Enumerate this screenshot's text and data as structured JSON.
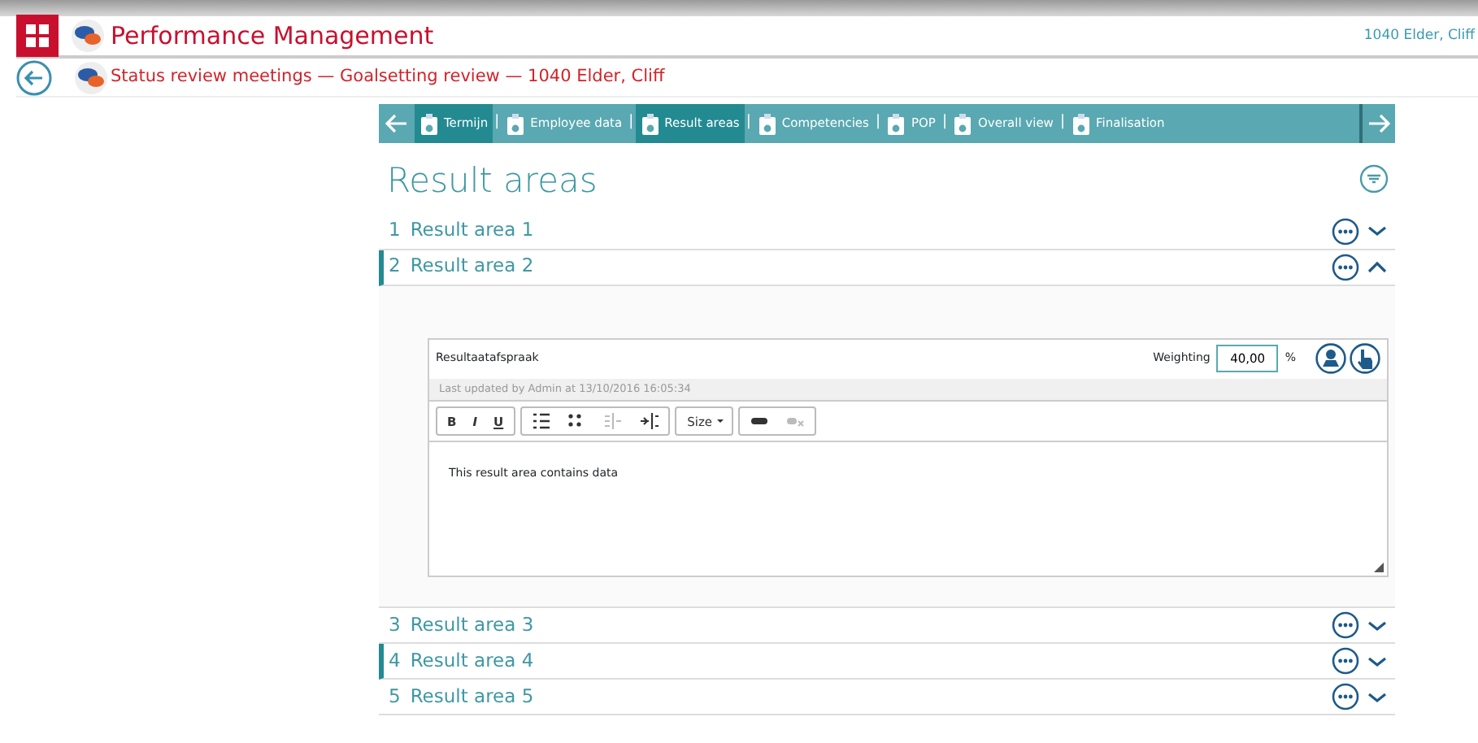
{
  "app": {
    "title": "Performance Management",
    "user": "1040 Elder, Cliff"
  },
  "breadcrumb": "Status review meetings — Goalsetting review — 1040 Elder, Cliff",
  "tabs": [
    {
      "label": "Termijn",
      "selected": true
    },
    {
      "label": "Employee data",
      "selected": false
    },
    {
      "label": "Result areas",
      "selected": true
    },
    {
      "label": "Competencies",
      "selected": false
    },
    {
      "label": "POP",
      "selected": false
    },
    {
      "label": "Overall view",
      "selected": false
    },
    {
      "label": "Finalisation",
      "selected": false
    }
  ],
  "tab_separator": "|",
  "heading": "Result areas",
  "areas": [
    {
      "number": "1",
      "title": "Result area 1",
      "expanded": false,
      "marked": false
    },
    {
      "number": "2",
      "title": "Result area 2",
      "expanded": true,
      "marked": true
    },
    {
      "number": "3",
      "title": "Result area 3",
      "expanded": false,
      "marked": false
    },
    {
      "number": "4",
      "title": "Result area 4",
      "expanded": false,
      "marked": true
    },
    {
      "number": "5",
      "title": "Result area 5",
      "expanded": false,
      "marked": false
    }
  ],
  "editor": {
    "title": "Resultaatafspraak",
    "weighting_label": "Weighting",
    "weighting": "40,00",
    "unit": "%",
    "updated": "Last updated by Admin at 13/10/2016 16:05:34",
    "toolbar": [
      {
        "buttons": [
          {
            "kind": "bold",
            "label": "B",
            "disabled": false
          },
          {
            "kind": "italic",
            "label": "I",
            "disabled": false
          },
          {
            "kind": "underline",
            "label": "U",
            "disabled": false
          }
        ]
      },
      {
        "buttons": [
          {
            "kind": "ordered",
            "disabled": false
          },
          {
            "kind": "bullets",
            "disabled": false
          },
          {
            "kind": "outdent",
            "disabled": true
          },
          {
            "kind": "indent",
            "disabled": false
          }
        ]
      },
      {
        "buttons": [
          {
            "kind": "size",
            "label": "Size",
            "disabled": false
          }
        ]
      },
      {
        "buttons": [
          {
            "kind": "link",
            "disabled": false
          },
          {
            "kind": "unlink",
            "disabled": true
          }
        ]
      }
    ],
    "body": "This result area contains data"
  }
}
